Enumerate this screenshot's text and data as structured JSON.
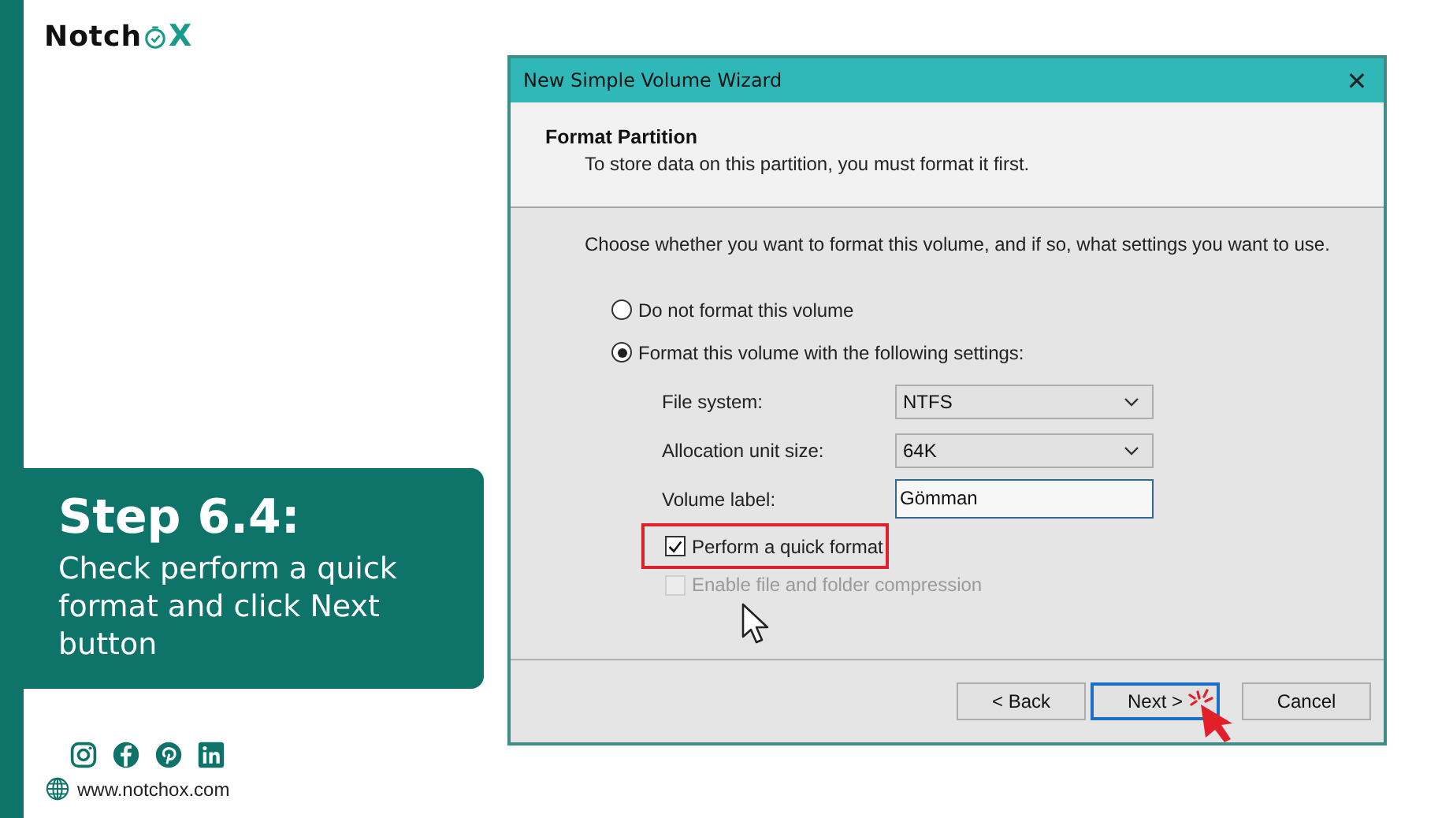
{
  "brand": {
    "logo_start": "Notch",
    "logo_end": "X"
  },
  "step": {
    "title": "Step 6.4:",
    "text": "Check perform a quick format and click Next button"
  },
  "footer": {
    "website": "www.notchox.com"
  },
  "window": {
    "title": "New Simple Volume Wizard",
    "close": "✕"
  },
  "header": {
    "title": "Format Partition",
    "subtitle": "To store data on this partition, you must format it first."
  },
  "instruction": "Choose whether you want to format this volume, and if so, what settings you want to use.",
  "options": [
    {
      "label": "Do not format this volume",
      "selected": false
    },
    {
      "label": "Format this volume with the following settings:",
      "selected": true
    }
  ],
  "fields": [
    {
      "kind": "select",
      "label": "File system:",
      "value": "NTFS"
    },
    {
      "kind": "select",
      "label": "Allocation unit size:",
      "value": "64K"
    },
    {
      "kind": "text",
      "label": "Volume label:",
      "value": "Gömman"
    }
  ],
  "checkboxes": [
    {
      "label": "Perform a quick format",
      "checked": true,
      "disabled": false,
      "highlighted": true
    },
    {
      "label": "Enable file and folder compression",
      "checked": false,
      "disabled": true,
      "highlighted": false
    }
  ],
  "buttons": [
    {
      "label": "< Back",
      "default": false
    },
    {
      "label": "Next >",
      "default": true
    },
    {
      "label": "Cancel",
      "default": false
    }
  ]
}
